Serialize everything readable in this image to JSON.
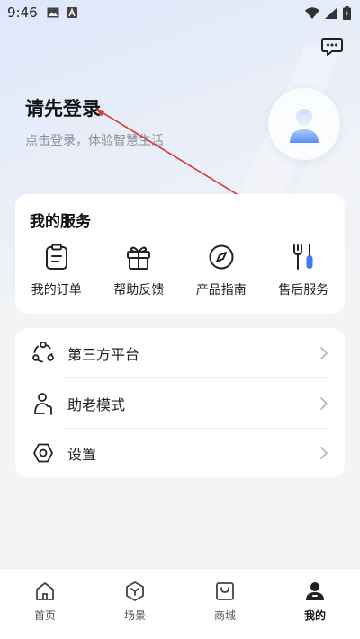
{
  "status_bar": {
    "time": "9:46"
  },
  "header": {
    "login_title": "请先登录",
    "login_subtitle": "点击登录，体验智慧生活"
  },
  "services": {
    "title": "我的服务",
    "items": [
      {
        "label": "我的订单",
        "icon": "clipboard-icon"
      },
      {
        "label": "帮助反馈",
        "icon": "gift-icon"
      },
      {
        "label": "产品指南",
        "icon": "compass-icon"
      },
      {
        "label": "售后服务",
        "icon": "tools-icon"
      }
    ]
  },
  "menu": {
    "items": [
      {
        "label": "第三方平台",
        "icon": "network-icon"
      },
      {
        "label": "助老模式",
        "icon": "elder-icon"
      },
      {
        "label": "设置",
        "icon": "settings-hex-icon"
      }
    ]
  },
  "tabbar": {
    "items": [
      {
        "label": "首页",
        "icon": "home-icon",
        "active": false
      },
      {
        "label": "场景",
        "icon": "scene-cube-icon",
        "active": false
      },
      {
        "label": "商城",
        "icon": "shopping-bag-icon",
        "active": false
      },
      {
        "label": "我的",
        "icon": "user-icon",
        "active": true
      }
    ]
  },
  "colors": {
    "accent": "#3d7bf2",
    "annotation_arrow": "#e0353b"
  }
}
